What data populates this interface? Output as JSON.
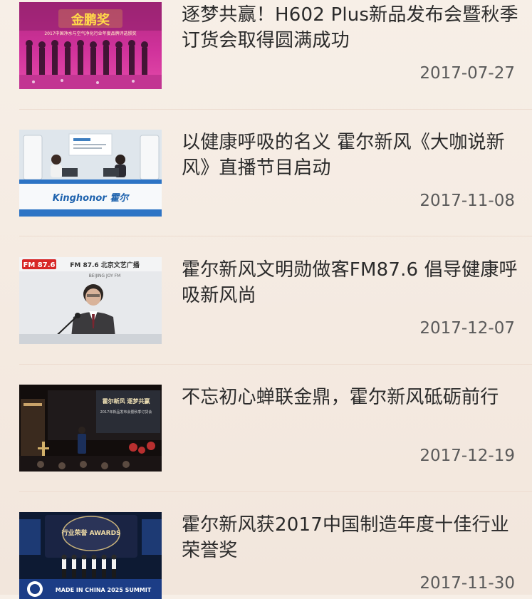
{
  "news": [
    {
      "title": "逐梦共赢！H602 Plus新品发布会暨秋季订货会取得圆满成功",
      "date": "2017-07-27",
      "thumb_caption": "金鹏奖",
      "thumb_subcaption": "2017中国净水与空气净化行业年度品牌评选颁奖"
    },
    {
      "title": "以健康呼吸的名义 霍尔新风《大咖说新风》直播节目启动",
      "date": "2017-11-08",
      "thumb_caption": "Kinghonor 霍尔",
      "thumb_subcaption": "KINGHONOR"
    },
    {
      "title": "霍尔新风文明勋做客FM87.6 倡导健康呼吸新风尚",
      "date": "2017-12-07",
      "thumb_caption": "FM 87.6 北京文艺广播",
      "thumb_subcaption": "BEIJING JOY FM"
    },
    {
      "title": "不忘初心蝉联金鼎，霍尔新风砥砺前行",
      "date": "2017-12-19",
      "thumb_caption": "霍尔新风 逐梦共赢",
      "thumb_subcaption": "2017年新品发布会暨秋季订货会"
    },
    {
      "title": "霍尔新风获2017中国制造年度十佳行业荣誉奖",
      "date": "2017-11-30",
      "thumb_caption": "行业荣誉 AWARDS",
      "thumb_subcaption": "MADE IN CHINA 2025 SUMMIT"
    }
  ]
}
